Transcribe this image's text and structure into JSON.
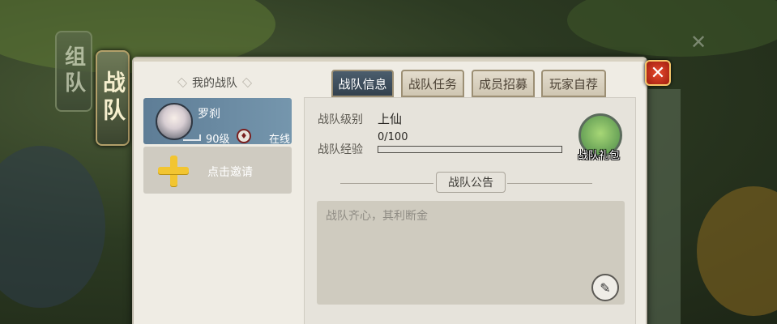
{
  "side_tabs": {
    "inactive": "组队",
    "active": "战队"
  },
  "left_panel": {
    "title": "我的战队",
    "member": {
      "name": "罗刹",
      "level": "90级",
      "status": "在线"
    },
    "invite_label": "点击邀请"
  },
  "tabs": [
    {
      "label": "战队信息",
      "active": true
    },
    {
      "label": "战队任务",
      "active": false
    },
    {
      "label": "成员招募",
      "active": false
    },
    {
      "label": "玩家自荐",
      "active": false
    }
  ],
  "info": {
    "level_label": "战队级别",
    "level_value": "上仙",
    "xp_label": "战队经验",
    "xp_value": "0/100",
    "xp_fraction": 0.0
  },
  "gift": {
    "label": "战队礼包",
    "icon": "gift-bag-icon"
  },
  "announcement": {
    "title": "战队公告",
    "text": "战队齐心，其利断金"
  },
  "colors": {
    "active_tab": "#3d4d5c",
    "close_button": "#c8321c",
    "plus": "#f2c531"
  }
}
